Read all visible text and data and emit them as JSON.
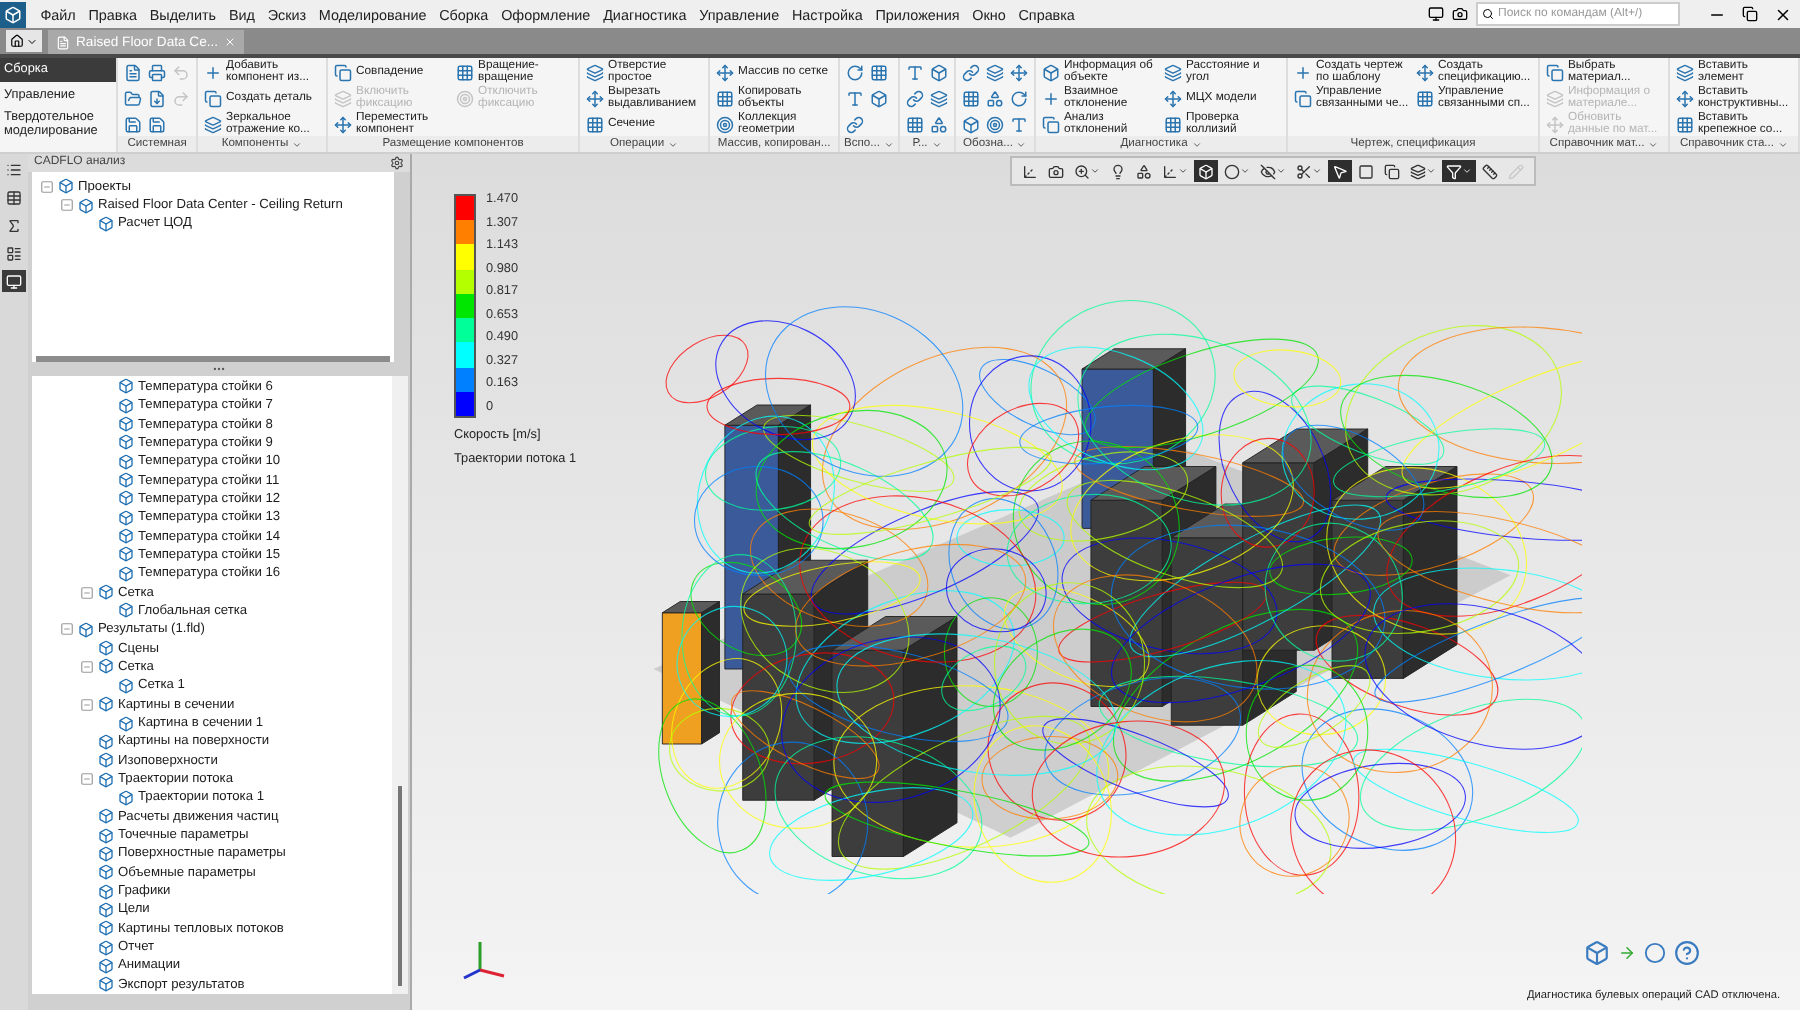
{
  "menu": [
    "Файл",
    "Правка",
    "Выделить",
    "Вид",
    "Эскиз",
    "Моделирование",
    "Сборка",
    "Оформление",
    "Диагностика",
    "Управление",
    "Настройка",
    "Приложения",
    "Окно",
    "Справка"
  ],
  "search": {
    "placeholder": "Поиск по командам (Alt+/)"
  },
  "document_tab": {
    "label": "Raised Floor Data Ce...",
    "selected": true
  },
  "ribbon": {
    "modes": [
      {
        "label": "Сборка",
        "selected": true
      },
      {
        "label": "Управление",
        "selected": false
      },
      {
        "label": "Твердотельное моделирование",
        "selected": false
      }
    ],
    "groups": [
      {
        "title": "Системная",
        "kind": "icons",
        "menu": false,
        "tools": [
          {
            "disabled": false
          },
          {
            "disabled": false
          },
          {
            "disabled": false
          },
          {
            "disabled": false
          },
          {
            "disabled": false
          },
          {
            "disabled": false
          },
          {
            "disabled": true
          },
          {
            "disabled": true
          }
        ]
      },
      {
        "title": "Компоненты",
        "kind": "buttons",
        "menu": true,
        "columns": [
          [
            {
              "label": "Добавить компонент из...",
              "disabled": false
            },
            {
              "label": "Создать деталь",
              "disabled": false
            },
            {
              "label": "Зеркальное отражение ко...",
              "disabled": false
            }
          ]
        ]
      },
      {
        "title": "Размещение компонентов",
        "kind": "buttons",
        "menu": false,
        "columns": [
          [
            {
              "label": "Совпадение",
              "disabled": false
            },
            {
              "label": "Включить фиксацию",
              "disabled": true
            },
            {
              "label": "Переместить компонент",
              "disabled": false
            }
          ],
          [
            {
              "label": "Вращение-вращение",
              "disabled": false
            },
            {
              "label": "Отключить фиксацию",
              "disabled": true
            }
          ]
        ]
      },
      {
        "title": "Операции",
        "kind": "buttons",
        "menu": true,
        "columns": [
          [
            {
              "label": "Отверстие простое",
              "disabled": false
            },
            {
              "label": "Вырезать выдавливанием",
              "disabled": false
            },
            {
              "label": "Сечение",
              "disabled": false
            }
          ]
        ]
      },
      {
        "title": "Массив, копирован...",
        "kind": "buttons",
        "menu": false,
        "columns": [
          [
            {
              "label": "Массив по сетке",
              "disabled": false
            },
            {
              "label": "Копировать объекты",
              "disabled": false
            },
            {
              "label": "Коллекция геометрии",
              "disabled": false
            }
          ]
        ]
      },
      {
        "title": "Вспо...",
        "kind": "icons",
        "menu": true,
        "tools": [
          {
            "disabled": false
          },
          {
            "disabled": false
          },
          {
            "disabled": false
          },
          {
            "disabled": false
          },
          {
            "disabled": false
          }
        ]
      },
      {
        "title": "Р...",
        "kind": "icons",
        "menu": true,
        "tools": [
          {
            "disabled": false
          },
          {
            "disabled": false
          },
          {
            "disabled": false
          },
          {
            "disabled": false
          },
          {
            "disabled": false
          },
          {
            "disabled": false
          }
        ]
      },
      {
        "title": "Обозна...",
        "kind": "icons",
        "menu": true,
        "tools": [
          {
            "disabled": false
          },
          {
            "disabled": false
          },
          {
            "disabled": false
          },
          {
            "disabled": false
          },
          {
            "disabled": false
          },
          {
            "disabled": false
          },
          {
            "disabled": false
          },
          {
            "disabled": false
          },
          {
            "disabled": false
          }
        ]
      },
      {
        "title": "Диагностика",
        "kind": "buttons",
        "menu": true,
        "columns": [
          [
            {
              "label": "Информация об объекте",
              "disabled": false
            },
            {
              "label": "Взаимное отклонение",
              "disabled": false
            },
            {
              "label": "Анализ отклонений",
              "disabled": false
            }
          ],
          [
            {
              "label": "Расстояние и угол",
              "disabled": false
            },
            {
              "label": "МЦХ модели",
              "disabled": false
            },
            {
              "label": "Проверка коллизий",
              "disabled": false
            }
          ]
        ]
      },
      {
        "title": "Чертеж, спецификация",
        "kind": "buttons",
        "menu": false,
        "columns": [
          [
            {
              "label": "Создать чертеж по шаблону",
              "disabled": false
            },
            {
              "label": "Управление связанными че...",
              "disabled": false
            }
          ],
          [
            {
              "label": "Создать спецификацию...",
              "disabled": false
            },
            {
              "label": "Управление связанными сп...",
              "disabled": false
            }
          ]
        ]
      },
      {
        "title": "Справочник мат...",
        "kind": "buttons",
        "menu": true,
        "columns": [
          [
            {
              "label": "Выбрать материал...",
              "disabled": false
            },
            {
              "label": "Информация о материале...",
              "disabled": true
            },
            {
              "label": "Обновить данные по мат...",
              "disabled": true
            }
          ]
        ]
      },
      {
        "title": "Справочник ста...",
        "kind": "buttons",
        "menu": true,
        "columns": [
          [
            {
              "label": "Вставить элемент",
              "disabled": false
            },
            {
              "label": "Вставить конструктивны...",
              "disabled": false
            },
            {
              "label": "Вставить крепежное со...",
              "disabled": false
            }
          ]
        ]
      }
    ]
  },
  "side_strip": [
    {
      "selected": false
    },
    {
      "selected": false
    },
    {
      "selected": false
    },
    {
      "selected": false
    },
    {
      "selected": true
    }
  ],
  "panel": {
    "title": "CADFLO анализ",
    "upper_tree": [
      {
        "label": "Проекты",
        "expanded": true,
        "children": [
          {
            "label": "Raised Floor Data Center - Ceiling Return",
            "expanded": true,
            "children": [
              {
                "label": "Расчет ЦОД",
                "expanded": false
              }
            ]
          }
        ]
      }
    ],
    "lower_tree": {
      "continued_items": [
        {
          "label": "Температура стойки 6",
          "expanded": false
        },
        {
          "label": "Температура стойки 7",
          "expanded": false
        },
        {
          "label": "Температура стойки 8",
          "expanded": false
        },
        {
          "label": "Температура стойки 9",
          "expanded": false
        },
        {
          "label": "Температура стойки 10",
          "expanded": false
        },
        {
          "label": "Температура стойки 11",
          "expanded": false
        },
        {
          "label": "Температура стойки 12",
          "expanded": false
        },
        {
          "label": "Температура стойки 13",
          "expanded": false
        },
        {
          "label": "Температура стойки 14",
          "expanded": false
        },
        {
          "label": "Температура стойки 15",
          "expanded": false
        },
        {
          "label": "Температура стойки 16",
          "expanded": false
        }
      ],
      "continued_nodes": [
        {
          "label": "Сетка",
          "expanded": true,
          "children": [
            {
              "label": "Глобальная сетка",
              "expanded": false
            }
          ]
        }
      ],
      "nodes": [
        {
          "label": "Результаты (1.fld)",
          "expanded": true,
          "children": [
            {
              "label": "Сцены",
              "expanded": false
            },
            {
              "label": "Сетка",
              "expanded": true,
              "children": [
                {
                  "label": "Сетка 1",
                  "expanded": false
                }
              ]
            },
            {
              "label": "Картины в сечении",
              "expanded": true,
              "children": [
                {
                  "label": "Картина в сечении 1",
                  "expanded": false
                }
              ]
            },
            {
              "label": "Картины на поверхности",
              "expanded": false
            },
            {
              "label": "Изоповерхности",
              "expanded": false
            },
            {
              "label": "Траектории потока",
              "expanded": true,
              "children": [
                {
                  "label": "Траектории потока 1",
                  "expanded": false
                }
              ]
            },
            {
              "label": "Расчеты движения частиц",
              "expanded": false
            },
            {
              "label": "Точечные параметры",
              "expanded": false
            },
            {
              "label": "Поверхностные параметры",
              "expanded": false
            },
            {
              "label": "Объемные параметры",
              "expanded": false
            },
            {
              "label": "Графики",
              "expanded": false
            },
            {
              "label": "Цели",
              "expanded": false
            },
            {
              "label": "Картины тепловых потоков",
              "expanded": false
            },
            {
              "label": "Отчет",
              "expanded": false
            },
            {
              "label": "Анимации",
              "expanded": false
            },
            {
              "label": "Экспорт результатов",
              "expanded": false
            }
          ]
        }
      ]
    }
  },
  "viewport_toolbar": [
    {
      "selected": false,
      "dropdown": false,
      "disabled": false
    },
    {
      "selected": false,
      "dropdown": false,
      "disabled": false
    },
    {
      "selected": false,
      "dropdown": true,
      "disabled": false
    },
    {
      "selected": false,
      "dropdown": false,
      "disabled": false
    },
    {
      "selected": false,
      "dropdown": false,
      "disabled": false
    },
    {
      "selected": false,
      "dropdown": true,
      "disabled": false
    },
    {
      "selected": true,
      "dropdown": false,
      "disabled": false
    },
    {
      "selected": false,
      "dropdown": true,
      "disabled": false
    },
    {
      "selected": false,
      "dropdown": true,
      "disabled": false
    },
    {
      "selected": false,
      "dropdown": true,
      "disabled": false
    },
    {
      "selected": true,
      "dropdown": false,
      "disabled": false
    },
    {
      "selected": false,
      "dropdown": false,
      "disabled": false
    },
    {
      "selected": false,
      "dropdown": false,
      "disabled": false
    },
    {
      "selected": false,
      "dropdown": true,
      "disabled": false
    },
    {
      "selected": true,
      "dropdown": true,
      "disabled": false
    },
    {
      "selected": false,
      "dropdown": false,
      "disabled": false
    },
    {
      "selected": false,
      "dropdown": false,
      "disabled": true
    }
  ],
  "legend": {
    "ticks": [
      "1.470",
      "1.307",
      "1.143",
      "0.980",
      "0.817",
      "0.653",
      "0.490",
      "0.327",
      "0.163",
      "0"
    ],
    "bands": [
      {
        "color": "#ff0000"
      },
      {
        "color": "#ff7f00"
      },
      {
        "color": "#ffff00"
      },
      {
        "color": "#b4ff00"
      },
      {
        "color": "#00e600"
      },
      {
        "color": "#00ff99"
      },
      {
        "color": "#00ffff"
      },
      {
        "color": "#0080ff"
      },
      {
        "color": "#0000ff"
      }
    ],
    "quantity": "Скорость [m/s]",
    "object": "Траектории потока 1"
  },
  "status": {
    "message": "Диагностика булевых операций CAD отключена."
  }
}
